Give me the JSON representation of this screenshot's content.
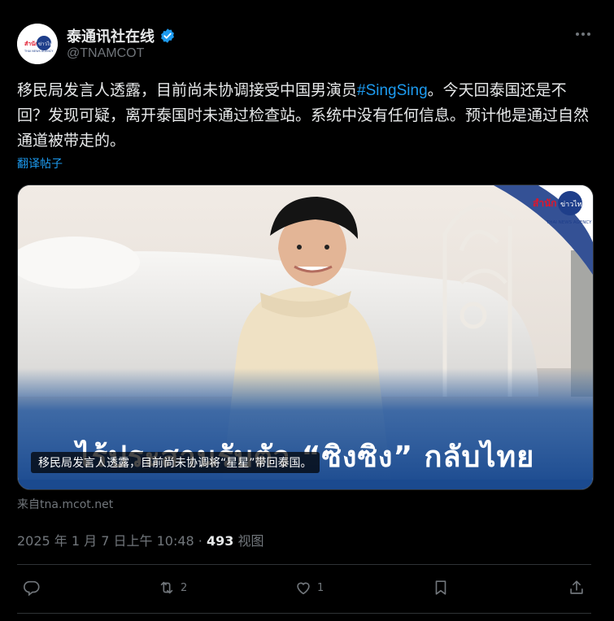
{
  "author": {
    "display_name": "泰通讯社在线",
    "handle": "@TNAMCOT",
    "avatar_text": "สำนักข่าวไทย",
    "avatar_subtext": "THAI NEWS AGENCY",
    "verified_icon": "verified-badge-icon"
  },
  "tweet": {
    "text_part1": "移民局发言人透露，目前尚未协调接受中国男演员",
    "hashtag": "#SingSing",
    "text_part2": "。今天回泰国还是不回？发现可疑，离开泰国时未通过检查站。系统中没有任何信息。预计他是通过自然通道被带走的。",
    "translate_label": "翻译帖子"
  },
  "media": {
    "headline": "ไร้ประสานรับตัว “ซิงซิง” กลับไทย",
    "caption": "移民局发言人透露，目前尚未协调将“星星”带回泰国。",
    "logo_text": "สำนักข่าวไทย",
    "logo_subtext": "THAI NEWS AGENCY"
  },
  "source_label": "来自tna.mcot.net",
  "meta": {
    "timestamp": "2025 年 1 月 7 日上午 10:48 · ",
    "views_count": "493",
    "views_label": " 视图"
  },
  "actions": {
    "reply_count": "",
    "retweet_count": "2",
    "like_count": "1",
    "bookmark_count": "",
    "share_count": ""
  },
  "colors": {
    "accent": "#1d9bf0",
    "muted": "#71767b",
    "background": "#000000"
  }
}
